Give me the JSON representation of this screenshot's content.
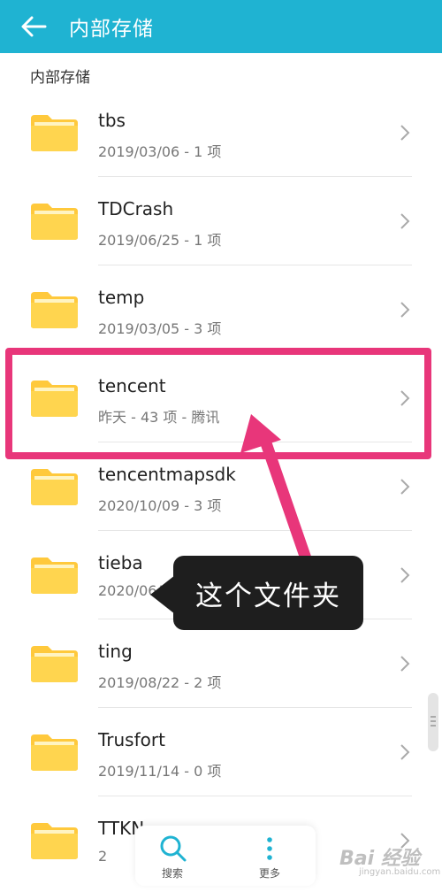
{
  "header": {
    "title": "内部存储",
    "back_icon": "arrow-left-icon",
    "background": "#1fb3d2"
  },
  "section_label": "内部存储",
  "folders": [
    {
      "name": "tbs",
      "meta": "2019/03/06 - 1 项"
    },
    {
      "name": "TDCrash",
      "meta": "2019/06/25 - 1 项"
    },
    {
      "name": "temp",
      "meta": "2019/03/05 - 3 项"
    },
    {
      "name": "tencent",
      "meta": "昨天 - 43 项 - 腾讯"
    },
    {
      "name": "tencentmapsdk",
      "meta": "2020/10/09 - 3 项"
    },
    {
      "name": "tieba",
      "meta": "2020/06/3"
    },
    {
      "name": "ting",
      "meta": "2019/08/22 - 2 项"
    },
    {
      "name": "Trusfort",
      "meta": "2019/11/14 - 0 项"
    },
    {
      "name": "TTKN",
      "meta": "2"
    }
  ],
  "annotation": {
    "callout_text": "这个文件夹",
    "highlight_color": "#e8367a"
  },
  "bottom_bar": {
    "search_label": "搜索",
    "more_label": "更多",
    "accent": "#1fb3d2"
  },
  "watermark": {
    "text": "Bai 经验",
    "sub": "jingyan.baidu.com"
  }
}
